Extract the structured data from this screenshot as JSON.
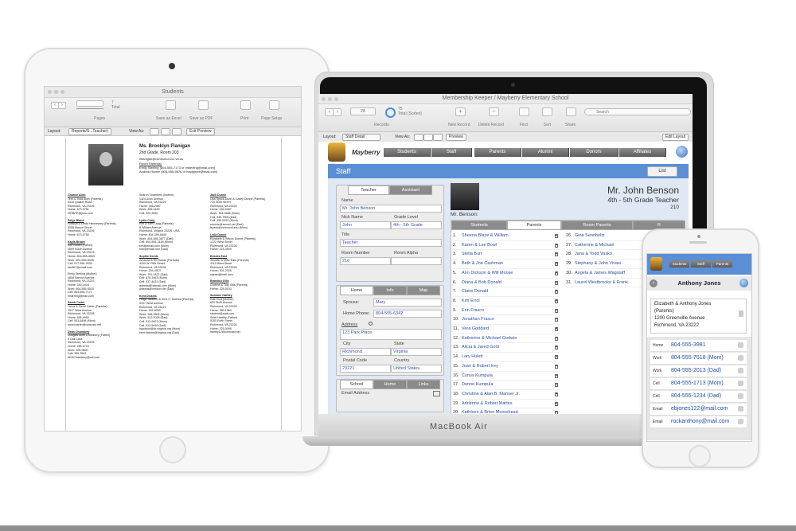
{
  "ipad": {
    "window_title": "Students",
    "toolbar": {
      "record_count": "7",
      "total_label": "Total",
      "pages_label": "Pages",
      "save_excel": "Save as Excel",
      "save_pdf": "Save as PDF",
      "print": "Print",
      "page_setup": "Page Setup"
    },
    "layoutbar": {
      "layout_label": "Layout:",
      "layout_value": "Reports/S...Teacher)",
      "view_as_label": "View As:",
      "exit_preview": "Exit Preview"
    },
    "teacher": {
      "name": "Ms. Brooklyn Flanigan",
      "grade_room": "2nd Grade, Room 203",
      "email": "eflanigan@richmond.k12.va.us",
      "parents_heading": "Room Parent(s)",
      "parent1": "Emily Sterling (804-555-7173 or msterling@mail.com)",
      "parent2": "Andrea Hunter (804-555-9876 or happytree@mail.com)"
    },
    "columns": [
      [
        {
          "name": "Chance Allen",
          "lines": [
            "Terri & Todd Allen (Parents)",
            "5410 Quaker Road",
            "Richmond, VA 23226",
            "Home: 673-0751",
            "ISRBRR@juno.com"
          ]
        },
        {
          "name": "Paige Bland",
          "lines": [
            "Rosslyn & Linda Hennessey (Parents)",
            "5308 Marion Street",
            "Richmond, VA 23226",
            "Home: 673-0755"
          ]
        },
        {
          "name": "Kayla Brown",
          "lines": [
            "Karl Brown (Father)",
            "4500 South Avenue",
            "Richmond, VA 23223",
            "Home: 804-555-0669",
            "Work: 804-555-8945",
            "Cell: 917-555-9536",
            "kar567@email.com"
          ]
        },
        {
          "name": "",
          "lines": [
            "Emily Sterling (Mother)",
            "4808 Narrow Avenue",
            "Richmond, VA 23223",
            "Home: 340-1934",
            "Work: 804-555-5033",
            "Cell: 804-555-7173",
            "msterling@mail.com"
          ]
        },
        {
          "name": "Sarah Carter",
          "lines": [
            "Laura & David Carter (Parents)",
            "3917 West Avenue",
            "Richmond, VA 23226",
            "Home: 555-4950",
            "Cell: 543-6498 (Mom)",
            "david.carter@comcast.net"
          ]
        },
        {
          "name": "Dean Chambery",
          "lines": [
            "Douglas Allen Chambery (Father)",
            "9 Oak Lane",
            "Richmond, VA 23226",
            "Home: 285-0724",
            "Work: 305-0600",
            "Cell: 305-3543",
            "AKDChambery@aol.com"
          ]
        }
      ],
      [
        {
          "name": "",
          "lines": [
            "Sharon Chambery (Mother)",
            "1424 Avon Avenue",
            "Richmond, VA 23226",
            "Home: 266-2087",
            "Work: 266-4499",
            "Cell: 920-3540"
          ]
        },
        {
          "name": "Lydia Craig",
          "lines": [
            "Kim & Tom Craig (Parents)",
            "8 William Avenue",
            "Richmond, Virginia 23226, USA",
            "Home: 804-399-6649",
            "Work: 804-555-3877 (Dad)",
            "Cell: 804-555-3159 (Mom)",
            "kim@email.com (Mom)",
            "tom@email.com (Dad)"
          ]
        },
        {
          "name": "Sophie Deeds",
          "lines": [
            "Amanda & Bill Deeds (Parents)",
            "4200 W. Fifth Street",
            "Richmond, VA 23226",
            "Home: 254-4513",
            "Work: 751-1822 (Dad)",
            "Cell: 878-3063 (Mom)",
            "Cell: 337-4431 (Dad)",
            "adeeds@hotmail.com (Mom)",
            "wdeeds@verizon.net (Dad)"
          ]
        },
        {
          "name": "Kent Dickins",
          "lines": [
            "Helga Jackson & Kent C. Dickins (Parents)",
            "4107 West Avenue",
            "Richmond, VA 23221",
            "Home: 342-8050",
            "Work: 288-2809 (Mom)",
            "Work: 512-2028 (Dad)",
            "Cell: 512-9907 (Mom)",
            "Cell: 512-5916 (Dad)",
            "hjackson@kc.virginia.org (Mom)",
            "kent.dickins@virginia.org (Dad)"
          ]
        }
      ],
      [
        {
          "name": "Jack Dunne",
          "lines": [
            "Lisa Speck-Dunn & Casey Dunne (Parents)",
            "700 Sixth Street",
            "Richmond, VA 23226",
            "Home: 232-0387",
            "Work: 783-2668 (Mom)",
            "Cell: 539-7905 (Dad)",
            "Cell: 396-5253 (Mom)",
            "cdunne@zavcel.net (Dad)",
            "lspeck@richmond.edu (Mom)"
          ]
        },
        {
          "name": "Leila Dunne",
          "lines": [
            "Elizabeth & Wilcox Dunne (Parents)",
            "1222 West Street",
            "Richmond, VA 23226",
            "Home: 224-3509"
          ]
        },
        {
          "name": "Brooks East",
          "lines": [
            "Jennifer & Mike East (Parents)",
            "4110 West Street",
            "Richmond, VA 23226",
            "Home: 301-2026",
            "mjeast@mail.com"
          ]
        },
        {
          "name": "Brandon Gills",
          "lines": [
            "Corinne & Tory Gills (Parents)",
            "Home: 225-0033"
          ]
        },
        {
          "name": "Summer Hartley",
          "lines": [
            "Rain Burt (Mother)",
            "600 Sixth Avenue",
            "Richmond, VA 23226",
            "Home: 380-1560",
            "rainburt@mail.com",
            "Scott Hartley (Father)",
            "9205 Forth Street",
            "Richmond, VA 23226",
            "Home: 225-0098",
            "hartley12@comcast.net"
          ]
        }
      ]
    ]
  },
  "mac": {
    "window_title": "Membership Keeper / Mayberry Elementary School",
    "toolbar": {
      "record_number": "28",
      "total_count": "75",
      "total_label": "Total (Sorted)",
      "records_label": "Records",
      "new_record": "New Record",
      "delete_record": "Delete Record",
      "find": "Find",
      "sort": "Sort",
      "share": "Share",
      "search_placeholder": "Search"
    },
    "layoutbar": {
      "layout_label": "Layout:",
      "layout_value": "Staff Detail",
      "view_as_label": "View As:",
      "preview": "Preview",
      "edit_layout": "Edit Layout"
    },
    "school_name": "Mayberry",
    "nav_tabs": [
      "Students",
      "Staff",
      "Parents",
      "Alumni",
      "Donors",
      "Affiliates"
    ],
    "section_title": "Staff",
    "list_button": "List",
    "teacher_tabs": [
      "Teacher",
      "Assistant"
    ],
    "fields": {
      "name_label": "Name",
      "name_value": "Mr. John Benson",
      "nick_label": "Nick Name",
      "nick_value": "John",
      "grade_label": "Grade Level",
      "grade_value": "4th - 5th Grade",
      "title_label": "Title",
      "title_value": "Teacher",
      "room_label": "Room Number",
      "room_value": "210",
      "room_alpha_label": "Room Alpha"
    },
    "home_tabs": [
      "Home",
      "Info",
      "Map"
    ],
    "home": {
      "spouse_label": "Spouse:",
      "spouse_value": "Mary",
      "phone_label": "Home Phone:",
      "phone_value": "804-555-6342",
      "address_label": "Address",
      "address_value": "123 Park Place",
      "city_label": "City",
      "city_value": "Richmond",
      "state_label": "State",
      "state_value": "Virginia",
      "postal_label": "Postal Code",
      "postal_value": "23221",
      "country_label": "Country",
      "country_value": "United States"
    },
    "school_tabs": [
      "School",
      "Home",
      "Links"
    ],
    "email_label": "Email Address",
    "header": {
      "name": "Mr. John Benson",
      "grade": "4th - 5th Grade Teacher",
      "room": "210",
      "caption": "Mr. Benson:"
    },
    "list_tabs": [
      "Students",
      "Parents",
      "Room Parents",
      "R"
    ],
    "students_left": [
      {
        "num": "1.",
        "name": "Sheena Blaze & William"
      },
      {
        "num": "2.",
        "name": "Karen & Lee Bowl"
      },
      {
        "num": "3.",
        "name": "Stella Burr"
      },
      {
        "num": "4.",
        "name": "Beth & Joe Cashman"
      },
      {
        "num": "5.",
        "name": "Ann Dickson & Will Moose"
      },
      {
        "num": "6.",
        "name": "Diana & Bob Donald"
      },
      {
        "num": "7.",
        "name": "Claire Donald"
      },
      {
        "num": "8.",
        "name": "Kim Errol"
      },
      {
        "num": "9.",
        "name": "Erin Frasco"
      },
      {
        "num": "10.",
        "name": "Jonathan Frasco"
      },
      {
        "num": "11.",
        "name": "Vera Goddard"
      },
      {
        "num": "12.",
        "name": "Katherine & Michael Godwin"
      },
      {
        "num": "13.",
        "name": "Alicia & Jared Gold"
      },
      {
        "num": "14.",
        "name": "Lary Hulett"
      },
      {
        "num": "15.",
        "name": "Joan & Robert Irey"
      },
      {
        "num": "16.",
        "name": "Cynus Kumpula"
      },
      {
        "num": "17.",
        "name": "Denne Kumpula"
      },
      {
        "num": "18.",
        "name": "Christine & Alan B. Manser Jr."
      },
      {
        "num": "19.",
        "name": "Adrienne & Robert Martes"
      },
      {
        "num": "20.",
        "name": "Kathleen & Brien Moorehead"
      }
    ],
    "students_right": [
      {
        "num": "26.",
        "name": "Gina Sennholtz"
      },
      {
        "num": "27.",
        "name": "Catherine & Michael"
      },
      {
        "num": "28.",
        "name": "Jana & Todd Vasko"
      },
      {
        "num": "29.",
        "name": "Stephany & John Vivasi"
      },
      {
        "num": "30.",
        "name": "Angela & James Wagstaff"
      },
      {
        "num": "31.",
        "name": "Laurel Westbrooke & Frank"
      }
    ],
    "brand": "MacBook Air"
  },
  "iphone": {
    "tabs": [
      "Students",
      "Staff",
      "Parents"
    ],
    "contact_name": "Anthony Jones",
    "address_lines": [
      "Elizabeth & Anthony Jones",
      "(Parents)",
      "1200 Greenville Avenue",
      "Richmond, VA 23222"
    ],
    "contacts": [
      {
        "type": "Home",
        "value": "804-555-3981"
      },
      {
        "type": "Work",
        "value": "804-555-7618 (Mom)"
      },
      {
        "type": "Work",
        "value": "804-555-2013 (Dad)"
      },
      {
        "type": "Cell",
        "value": "804-555-1713 (Mom)"
      },
      {
        "type": "Cell",
        "value": "804-555-1234 (Dad)"
      },
      {
        "type": "Email",
        "value": "ebjones122@mail.com"
      },
      {
        "type": "Email",
        "value": "rockanthony@mail.com"
      }
    ]
  },
  "colors": {
    "accent_blue": "#5a8fd6",
    "link_blue": "#2b4fa0",
    "tab_gray": "#6e6e6e"
  }
}
